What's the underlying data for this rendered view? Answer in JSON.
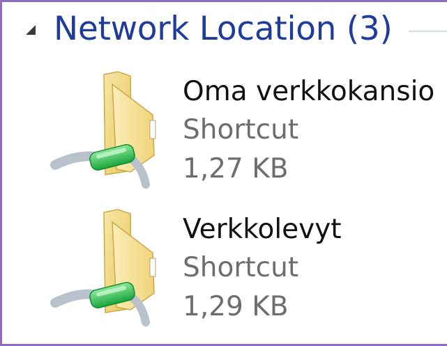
{
  "group": {
    "title": "Network Location (3)",
    "toggle_icon": "collapse-triangle-icon"
  },
  "items": [
    {
      "name": "Oma verkkokansio",
      "type": "Shortcut",
      "size": "1,27 KB",
      "icon": "network-folder-icon"
    },
    {
      "name": "Verkkolevyt",
      "type": "Shortcut",
      "size": "1,29 KB",
      "icon": "network-folder-icon"
    }
  ],
  "colors": {
    "frame_border": "#8f6ec0",
    "group_title": "#1f3c9b",
    "secondary_text": "#6d6d6d",
    "folder_yellow": "#f3d77a",
    "cable_green": "#2dbb4a"
  }
}
